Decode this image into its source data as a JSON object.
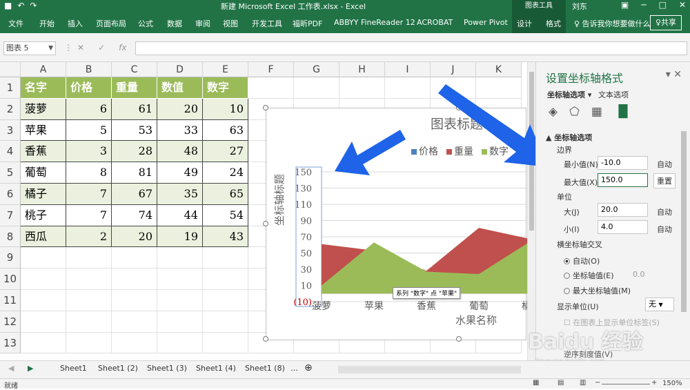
{
  "titlebar": {
    "title": "新建 Microsoft Excel 工作表.xlsx  -  Excel",
    "context_group": "图表工具",
    "user": "刘东",
    "undo": "↶",
    "redo": "↷"
  },
  "tabs": [
    "文件",
    "开始",
    "插入",
    "页面布局",
    "公式",
    "数据",
    "审阅",
    "视图",
    "开发工具",
    "福昕PDF",
    "ABBYY FineReader 12",
    "ACROBAT",
    "Power Pivot",
    "设计",
    "格式"
  ],
  "tell_me": "♀ 告诉我你想要做什么",
  "share": "♀共享",
  "formula_bar": {
    "name_box": "图表 5",
    "formula": ""
  },
  "columns": [
    "A",
    "B",
    "C",
    "D",
    "E",
    "F",
    "G",
    "H",
    "I",
    "J",
    "K"
  ],
  "rows": [
    "1",
    "2",
    "3",
    "4",
    "5",
    "6",
    "7",
    "8",
    "9",
    "10",
    "11",
    "12",
    "13"
  ],
  "table": {
    "headers": [
      "名字",
      "价格",
      "重量",
      "数值",
      "数字"
    ],
    "rows": [
      [
        "菠萝",
        "6",
        "61",
        "20",
        "10"
      ],
      [
        "苹果",
        "5",
        "53",
        "33",
        "63"
      ],
      [
        "香蕉",
        "3",
        "28",
        "48",
        "27"
      ],
      [
        "葡萄",
        "8",
        "81",
        "49",
        "24"
      ],
      [
        "橘子",
        "7",
        "67",
        "35",
        "65"
      ],
      [
        "桃子",
        "7",
        "74",
        "44",
        "54"
      ],
      [
        "西瓜",
        "2",
        "20",
        "19",
        "43"
      ]
    ]
  },
  "chart": {
    "title": "图表标题",
    "legend": [
      "价格",
      "重量",
      "数字"
    ],
    "yaxis_title": "坐标轴标题",
    "xaxis_title": "水果名称",
    "tooltip": "系列 \"数字\" 点 \"苹果\"",
    "colors": {
      "价格": "#4f81bd",
      "重量": "#c0504d",
      "数字": "#9bbb59"
    }
  },
  "chart_data": {
    "type": "area",
    "categories": [
      "菠萝",
      "苹果",
      "香蕉",
      "葡萄",
      "橘子"
    ],
    "series": [
      {
        "name": "价格",
        "values": [
          6,
          5,
          3,
          8,
          7
        ]
      },
      {
        "name": "重量",
        "values": [
          61,
          53,
          28,
          81,
          67
        ]
      },
      {
        "name": "数字",
        "values": [
          10,
          63,
          27,
          24,
          65
        ]
      }
    ],
    "ylim": [
      -10,
      150
    ],
    "yticks": [
      "(10)",
      "10",
      "30",
      "50",
      "70",
      "90",
      "110",
      "130",
      "150"
    ],
    "xlabel": "水果名称",
    "ylabel": "坐标轴标题",
    "title": "图表标题",
    "legend_position": "top"
  },
  "panel": {
    "title": "设置坐标轴格式",
    "tab1": "坐标轴选项 ▾",
    "tab2": "文本选项",
    "section": "▲ 坐标轴选项",
    "bounds": "边界",
    "min_label": "最小值(N)",
    "min_value": "-10.0",
    "min_btn": "自动",
    "max_label": "最大值(X)",
    "max_value": "150.0",
    "max_btn": "重置",
    "units": "单位",
    "major_label": "大(J)",
    "major_value": "20.0",
    "major_btn": "自动",
    "minor_label": "小(I)",
    "minor_value": "4.0",
    "minor_btn": "自动",
    "cross": "横坐标轴交叉",
    "opt_auto": "自动(O)",
    "opt_value": "坐标轴值(E)",
    "opt_value_num": "0.0",
    "opt_max": "最大坐标轴值(M)",
    "display_unit": "显示单位(U)",
    "display_unit_value": "无",
    "show_unit": "在图表上显示单位标签(S)",
    "reverse": "逆序刻度值(V)"
  },
  "sheets": [
    "Sheet1",
    "Sheet1 (2)",
    "Sheet1 (3)",
    "Sheet1 (4)",
    "Sheet1 (8)"
  ],
  "status": {
    "ready": "就绪",
    "zoom": "150%"
  },
  "watermark": {
    "text": "Baidu 经验",
    "sub": "jingyan.baidu.com"
  }
}
